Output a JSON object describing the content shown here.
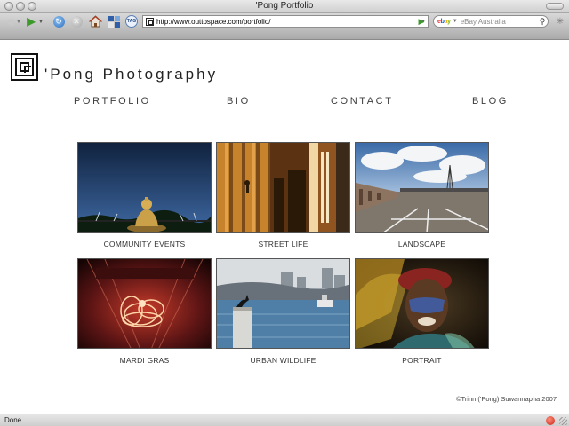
{
  "window": {
    "title": "'Pong Portfolio"
  },
  "toolbar": {
    "url": "http://www.outtospace.com/portfolio/",
    "search_placeholder": "eBay Australia",
    "tag_label": "TAG"
  },
  "site": {
    "title": "'Pong Photography",
    "nav": [
      "PORTFOLIO",
      "BIO",
      "CONTACT",
      "BLOG"
    ]
  },
  "gallery": [
    {
      "caption": "COMMUNITY EVENTS"
    },
    {
      "caption": "STREET LIFE"
    },
    {
      "caption": "LANDSCAPE"
    },
    {
      "caption": "MARDI GRAS"
    },
    {
      "caption": "URBAN WILDLIFE"
    },
    {
      "caption": "PORTRAIT"
    }
  ],
  "footer": {
    "copyright": "©Trinn ('Pong) Suwannapha 2007"
  },
  "status": {
    "text": "Done"
  }
}
